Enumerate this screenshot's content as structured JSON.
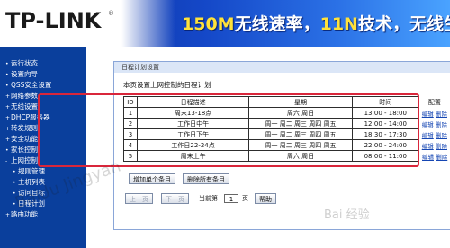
{
  "header": {
    "logo": "TP-LINK",
    "registered": "®",
    "slogan_part1": "150M",
    "slogan_part2": "无线速率，",
    "slogan_part3": "11N",
    "slogan_part4": "技术，无线生活新选择"
  },
  "sidebar": {
    "items": [
      {
        "label": "运行状态"
      },
      {
        "label": "设置向导"
      },
      {
        "label": "QSS安全设置"
      },
      {
        "label": "网络参数"
      },
      {
        "label": "无线设置"
      },
      {
        "label": "DHCP服务器"
      },
      {
        "label": "转发规则"
      },
      {
        "label": "安全功能"
      },
      {
        "label": "家长控制"
      },
      {
        "label": "上网控制"
      },
      {
        "label": "规则管理"
      },
      {
        "label": "主机列表"
      },
      {
        "label": "访问目标"
      },
      {
        "label": "日程计划"
      },
      {
        "label": "路由功能"
      }
    ]
  },
  "panel": {
    "title": "日程计划设置",
    "description": "本页设置上网控制的日程计划",
    "columns": {
      "id": "ID",
      "desc": "日程描述",
      "week": "星期",
      "time": "时间",
      "config": "配置"
    },
    "rows": [
      {
        "id": "1",
        "desc": "周末13-18点",
        "week": "周六  周日",
        "time": "13:00 - 18:00",
        "edit": "编辑",
        "delete": "删除"
      },
      {
        "id": "2",
        "desc": "工作日中午",
        "week": "周一  周二  周三  周四  周五",
        "time": "12:00 - 14:00",
        "edit": "编辑",
        "delete": "删除"
      },
      {
        "id": "3",
        "desc": "工作日下午",
        "week": "周一  周二  周三  周四  周五",
        "time": "18:30 - 17:30",
        "edit": "编辑",
        "delete": "删除"
      },
      {
        "id": "4",
        "desc": "工作日22-24点",
        "week": "周一  周二  周三  周四  周五",
        "time": "22:00 - 24:00",
        "edit": "编辑",
        "delete": "删除"
      },
      {
        "id": "5",
        "desc": "周末上午",
        "week": "周六  周日",
        "time": "08:00 - 11:00",
        "edit": "编辑",
        "delete": "删除"
      }
    ],
    "buttons": {
      "add": "增加单个条目",
      "delete_all": "删除所有条目"
    },
    "pager": {
      "prev": "上一页",
      "next": "下一页",
      "current_label": "当前第",
      "page": "1",
      "page_unit": "页",
      "help": "帮助"
    }
  },
  "watermarks": {
    "left": "Baidu Jingyan",
    "right": "Bai 经验"
  }
}
